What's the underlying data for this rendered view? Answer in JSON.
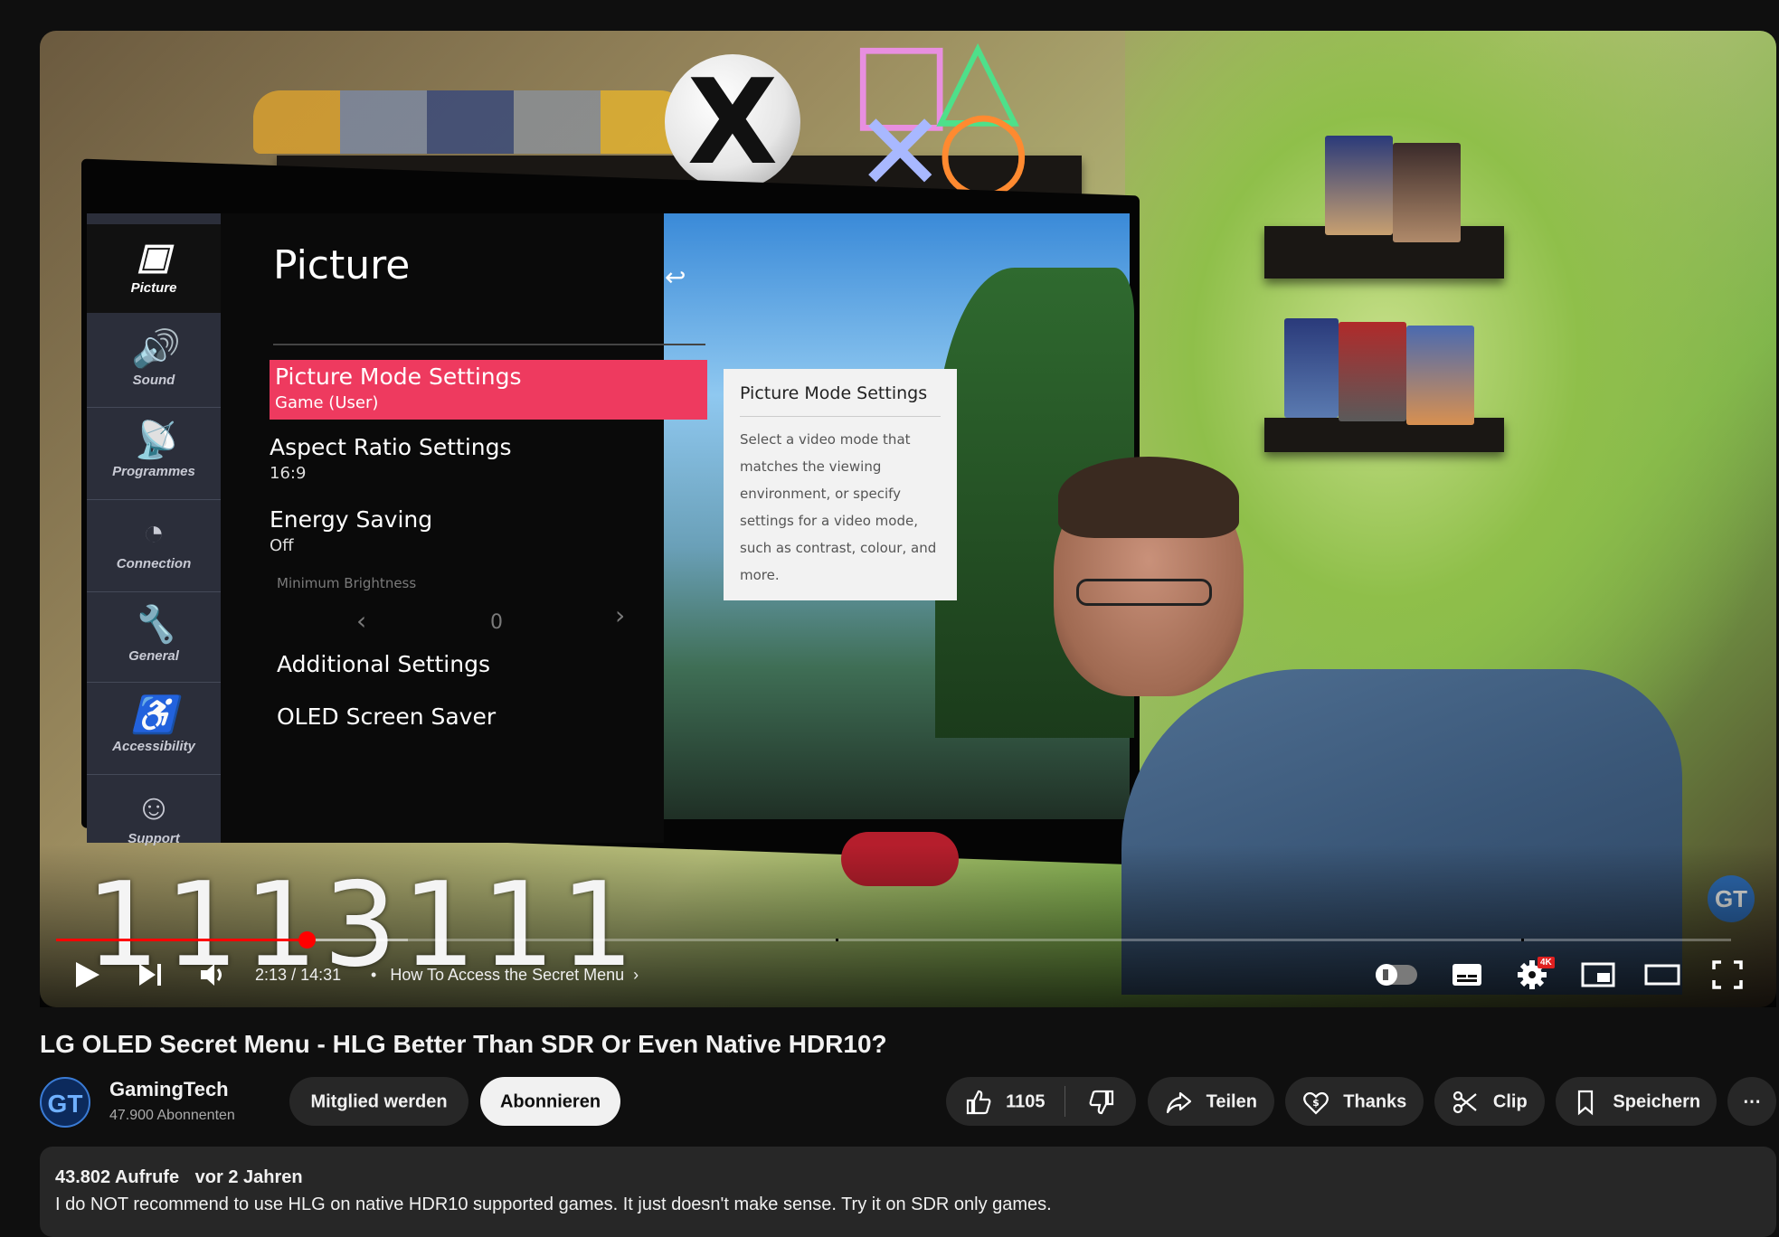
{
  "tv_menu": {
    "sidebar": [
      {
        "label": "Picture",
        "icon": "picture-icon"
      },
      {
        "label": "Sound",
        "icon": "speaker-icon"
      },
      {
        "label": "Programmes",
        "icon": "satellite-icon"
      },
      {
        "label": "Connection",
        "icon": "globe-icon"
      },
      {
        "label": "General",
        "icon": "wrench-icon"
      },
      {
        "label": "Accessibility",
        "icon": "accessibility-icon"
      },
      {
        "label": "Support",
        "icon": "support-icon"
      }
    ],
    "title": "Picture",
    "items": [
      {
        "title": "Picture Mode Settings",
        "sub": "Game (User)"
      },
      {
        "title": "Aspect Ratio Settings",
        "sub": "16:9"
      },
      {
        "title": "Energy Saving",
        "sub": "Off"
      },
      {
        "title": "Additional Settings",
        "sub": ""
      },
      {
        "title": "OLED Screen Saver",
        "sub": ""
      }
    ],
    "min_brightness_label": "Minimum Brightness",
    "min_brightness_value": "0",
    "tooltip_title": "Picture Mode Settings",
    "tooltip_body": "Select a video mode that matches the viewing environment, or specify settings for a video mode, such as contrast, colour, and more."
  },
  "overlay_numbers": "1113111",
  "player": {
    "progress_fraction": 0.1495,
    "buffered_fraction": 0.21,
    "current_time": "2:13",
    "duration": "14:31",
    "time_separator": "/",
    "chapter": "How To Access the Secret Menu",
    "quality_badge": "4K"
  },
  "video": {
    "title": "LG OLED Secret Menu - HLG Better Than SDR Or Even Native HDR10?"
  },
  "channel": {
    "name": "GamingTech",
    "subscribers": "47.900 Abonnenten",
    "avatar_text": "GT"
  },
  "actions": {
    "join": "Mitglied werden",
    "subscribe": "Abonnieren",
    "likes": "1105",
    "share": "Teilen",
    "thanks": "Thanks",
    "clip": "Clip",
    "save": "Speichern",
    "more": "⋯"
  },
  "description": {
    "views": "43.802 Aufrufe",
    "age": "vor 2 Jahren",
    "text": "I do NOT recommend to use HLG on native HDR10 supported games. It just doesn't make sense. Try it on SDR only games."
  },
  "colors": {
    "accent_red": "#ff0000",
    "lg_select": "#ee3a5f",
    "background": "#0f0f0f",
    "pill": "#272727"
  }
}
